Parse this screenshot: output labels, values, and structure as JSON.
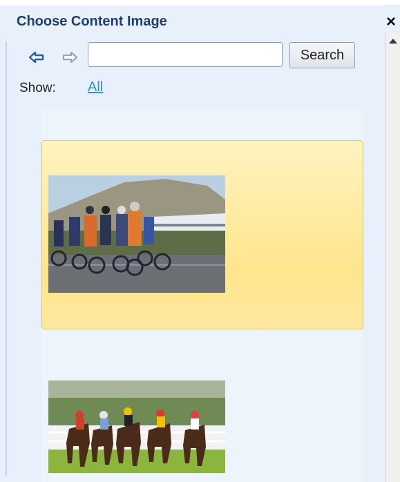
{
  "panel": {
    "title": "Choose Content Image",
    "close_glyph": "×"
  },
  "toolbar": {
    "back_icon": "back-arrow-icon",
    "forward_icon": "forward-arrow-icon",
    "search_value": "",
    "search_label": "Search"
  },
  "filter": {
    "show_label": "Show:",
    "all_label": "All"
  },
  "results": [
    {
      "image": "cyclists-racing-photo",
      "selected": true
    },
    {
      "image": "horse-racing-photo",
      "selected": false
    }
  ],
  "colors": {
    "title": "#1f3d6e",
    "link": "#2f8fd9",
    "selection_fill": "#ffe58c",
    "selection_border": "#e3c56a",
    "panel_bg": "#e8f0fb"
  }
}
